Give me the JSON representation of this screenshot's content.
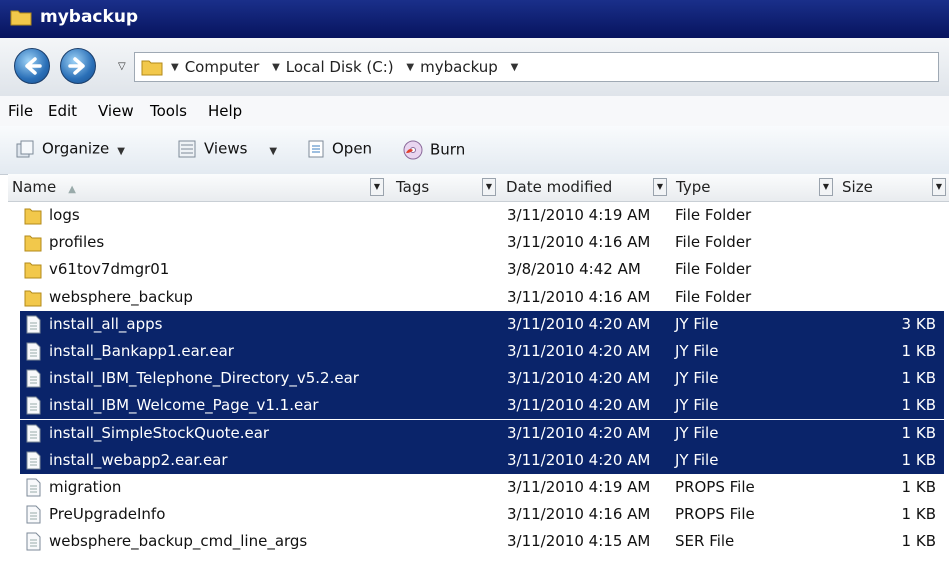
{
  "window": {
    "title": "mybackup"
  },
  "address": {
    "crumbs": [
      "Computer",
      "Local Disk (C:)",
      "mybackup"
    ]
  },
  "menu": {
    "file": "File",
    "edit": "Edit",
    "view": "View",
    "tools": "Tools",
    "help": "Help"
  },
  "toolbar": {
    "organize": "Organize",
    "views": "Views",
    "open": "Open",
    "burn": "Burn"
  },
  "columns": {
    "name": "Name",
    "tags": "Tags",
    "date": "Date modified",
    "type": "Type",
    "size": "Size"
  },
  "files": [
    {
      "name": "logs",
      "date": "3/11/2010 4:19 AM",
      "type": "File Folder",
      "size": "",
      "kind": "folder",
      "selected": false
    },
    {
      "name": "profiles",
      "date": "3/11/2010 4:16 AM",
      "type": "File Folder",
      "size": "",
      "kind": "folder",
      "selected": false
    },
    {
      "name": "v61tov7dmgr01",
      "date": "3/8/2010 4:42 AM",
      "type": "File Folder",
      "size": "",
      "kind": "folder",
      "selected": false
    },
    {
      "name": "websphere_backup",
      "date": "3/11/2010 4:16 AM",
      "type": "File Folder",
      "size": "",
      "kind": "folder",
      "selected": false
    },
    {
      "name": "install_all_apps",
      "date": "3/11/2010 4:20 AM",
      "type": "JY File",
      "size": "3 KB",
      "kind": "file",
      "selected": true
    },
    {
      "name": "install_Bankapp1.ear.ear",
      "date": "3/11/2010 4:20 AM",
      "type": "JY File",
      "size": "1 KB",
      "kind": "file",
      "selected": true
    },
    {
      "name": "install_IBM_Telephone_Directory_v5.2.ear",
      "date": "3/11/2010 4:20 AM",
      "type": "JY File",
      "size": "1 KB",
      "kind": "file",
      "selected": true
    },
    {
      "name": "install_IBM_Welcome_Page_v1.1.ear",
      "date": "3/11/2010 4:20 AM",
      "type": "JY File",
      "size": "1 KB",
      "kind": "file",
      "selected": true
    },
    {
      "name": "install_SimpleStockQuote.ear",
      "date": "3/11/2010 4:20 AM",
      "type": "JY File",
      "size": "1 KB",
      "kind": "file",
      "selected": true
    },
    {
      "name": "install_webapp2.ear.ear",
      "date": "3/11/2010 4:20 AM",
      "type": "JY File",
      "size": "1 KB",
      "kind": "file",
      "selected": true
    },
    {
      "name": "migration",
      "date": "3/11/2010 4:19 AM",
      "type": "PROPS File",
      "size": "1 KB",
      "kind": "file",
      "selected": false
    },
    {
      "name": "PreUpgradeInfo",
      "date": "3/11/2010 4:16 AM",
      "type": "PROPS File",
      "size": "1 KB",
      "kind": "file",
      "selected": false
    },
    {
      "name": "websphere_backup_cmd_line_args",
      "date": "3/11/2010 4:15 AM",
      "type": "SER File",
      "size": "1 KB",
      "kind": "file",
      "selected": false
    }
  ],
  "colors": {
    "selection": "#0a246a",
    "titlebar": "#0d1f76",
    "folder": "#f2c84b"
  }
}
